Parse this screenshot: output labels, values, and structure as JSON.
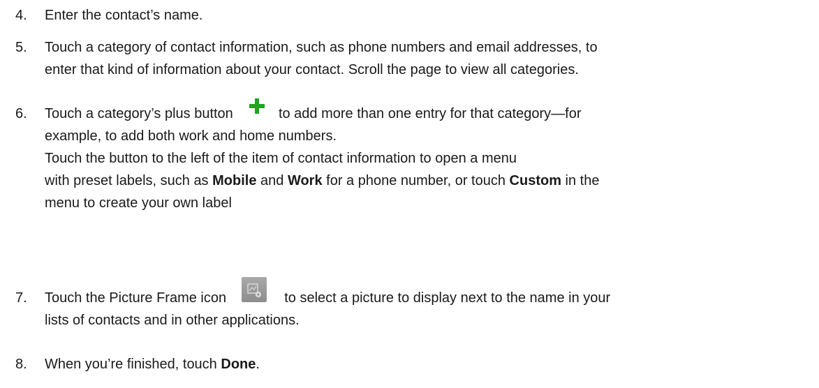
{
  "steps": [
    {
      "number": "4.",
      "lines": [
        "Enter the contact’s name."
      ]
    },
    {
      "number": "5.",
      "line1": "Touch a category of contact information, such as phone numbers and email addresses, to",
      "line2": "enter that kind of information about your contact. Scroll the page to view all categories."
    },
    {
      "number": "6.",
      "line1_before": "Touch a category’s plus button",
      "line1_after": "to add more than one entry for that category—for",
      "line2": "example, to add both work and home numbers.",
      "line3": "Touch the button to the left of the item of contact information to open a menu",
      "line4_a": "with preset labels, such as ",
      "line4_b": "Mobile",
      "line4_c": " and ",
      "line4_d": "Work",
      "line4_e": " for a phone number, or touch ",
      "line4_f": "Custom",
      "line4_g": " in the",
      "line5": "menu to create your own label",
      "plus_icon": "plus-icon",
      "plus_color": "#1fa51f"
    },
    {
      "number": "7.",
      "line1_before": "Touch the Picture Frame icon",
      "line1_after": "to select a picture to display next to the name in your",
      "line2": "lists of contacts and in other applications.",
      "frame_icon": "picture-frame-icon"
    },
    {
      "number": "8.",
      "line1_a": "When you’re finished, touch ",
      "line1_b": "Done",
      "line1_c": "."
    }
  ]
}
